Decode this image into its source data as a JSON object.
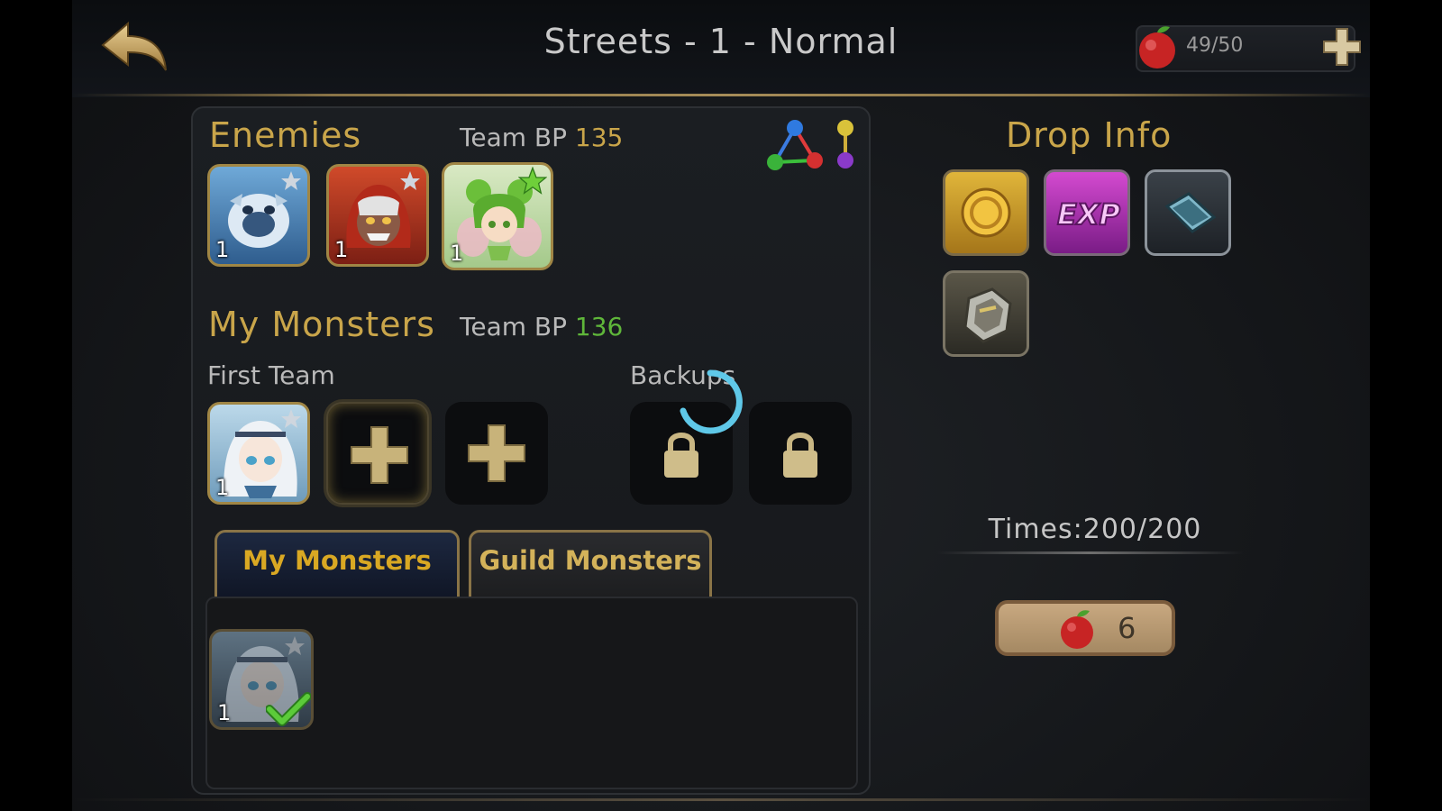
{
  "header": {
    "title": "Streets - 1 - Normal",
    "energy": "49/50"
  },
  "enemies": {
    "title": "Enemies",
    "bp_label": "Team BP",
    "bp_value": "135",
    "cards": [
      {
        "level": "1",
        "monster": "blue-yeti"
      },
      {
        "level": "1",
        "monster": "red-hood-girl"
      },
      {
        "level": "1",
        "monster": "green-fairy"
      }
    ]
  },
  "my_monsters": {
    "title": "My Monsters",
    "bp_label": "Team BP",
    "bp_value": "136",
    "first_team_label": "First Team",
    "backups_label": "Backups",
    "first_team_card": {
      "level": "1",
      "monster": "white-hair-girl"
    },
    "list": [
      {
        "level": "1",
        "monster": "white-hair-girl",
        "selected": true
      }
    ]
  },
  "tabs": [
    {
      "label": "My Monsters",
      "active": true
    },
    {
      "label": "Guild Monsters",
      "active": false
    }
  ],
  "drop_info": {
    "title": "Drop Info",
    "items": [
      "gold-coin-icon",
      "exp-icon",
      "gem-icon",
      "gear-armor-icon"
    ],
    "times": "Times:200/200"
  },
  "start": {
    "cost": "6"
  },
  "colors": {
    "gold": "#c9a54a",
    "green": "#5fb63a",
    "accent_gold_border": "#a08645"
  }
}
